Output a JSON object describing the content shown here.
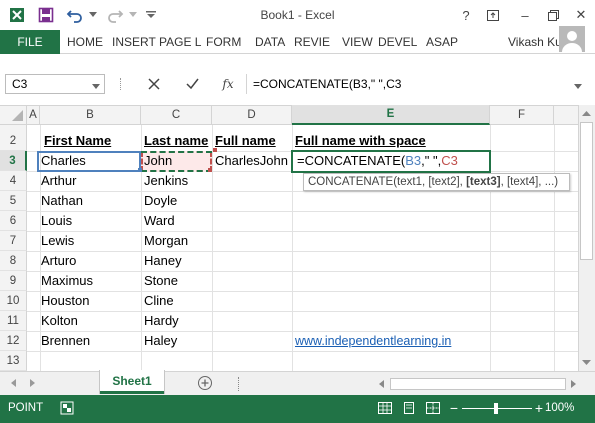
{
  "titlebar": {
    "title": "Book1 - Excel",
    "help": "?",
    "minimize": "–",
    "close": "✕"
  },
  "ribbon": {
    "file": "FILE",
    "tabs": [
      "HOME",
      "INSERT",
      "PAGE L",
      "FORM",
      "DATA",
      "REVIE",
      "VIEW",
      "DEVEL",
      "ASAP"
    ],
    "user": "Vikash Ku..."
  },
  "formula_bar": {
    "name_box": "C3",
    "fx": "fx",
    "formula": "=CONCATENATE(B3,\" \",C3"
  },
  "columns": [
    "A",
    "B",
    "C",
    "D",
    "E",
    "F"
  ],
  "rows": [
    "2",
    "3",
    "4",
    "5",
    "6",
    "7",
    "8",
    "9",
    "10",
    "11",
    "12",
    "13"
  ],
  "headers": {
    "first_name": "First Name",
    "last_name": "Last name",
    "full_name": "Full name",
    "full_name_space": "Full name with space"
  },
  "first_names": [
    "Charles",
    "Arthur",
    "Nathan",
    "Louis",
    "Lewis",
    "Arturo",
    "Maximus",
    "Houston",
    "Kolton",
    "Brennen"
  ],
  "last_names": [
    "John",
    "Jenkins",
    "Doyle",
    "Ward",
    "Morgan",
    "Haney",
    "Stone",
    "Cline",
    "Hardy",
    "Haley"
  ],
  "d3_value": "CharlesJohn",
  "editing_cell": {
    "prefix": "=CONCATENATE(",
    "ref1": "B3",
    "middle": ",\" \",",
    "ref2": "C3",
    "ref1_color": "#4f81bd",
    "ref2_color": "#c0504d"
  },
  "tooltip": {
    "fn": "CONCATENATE(",
    "args": "text1, [text2], ",
    "active": "[text3]",
    "rest": ", [text4], ...)"
  },
  "link": "www.independentlearning.in",
  "sheet_tab": "Sheet1",
  "status": {
    "mode": "POINT",
    "zoom": "100%"
  },
  "colors": {
    "accent": "#217346",
    "link": "#1a5fb4"
  }
}
